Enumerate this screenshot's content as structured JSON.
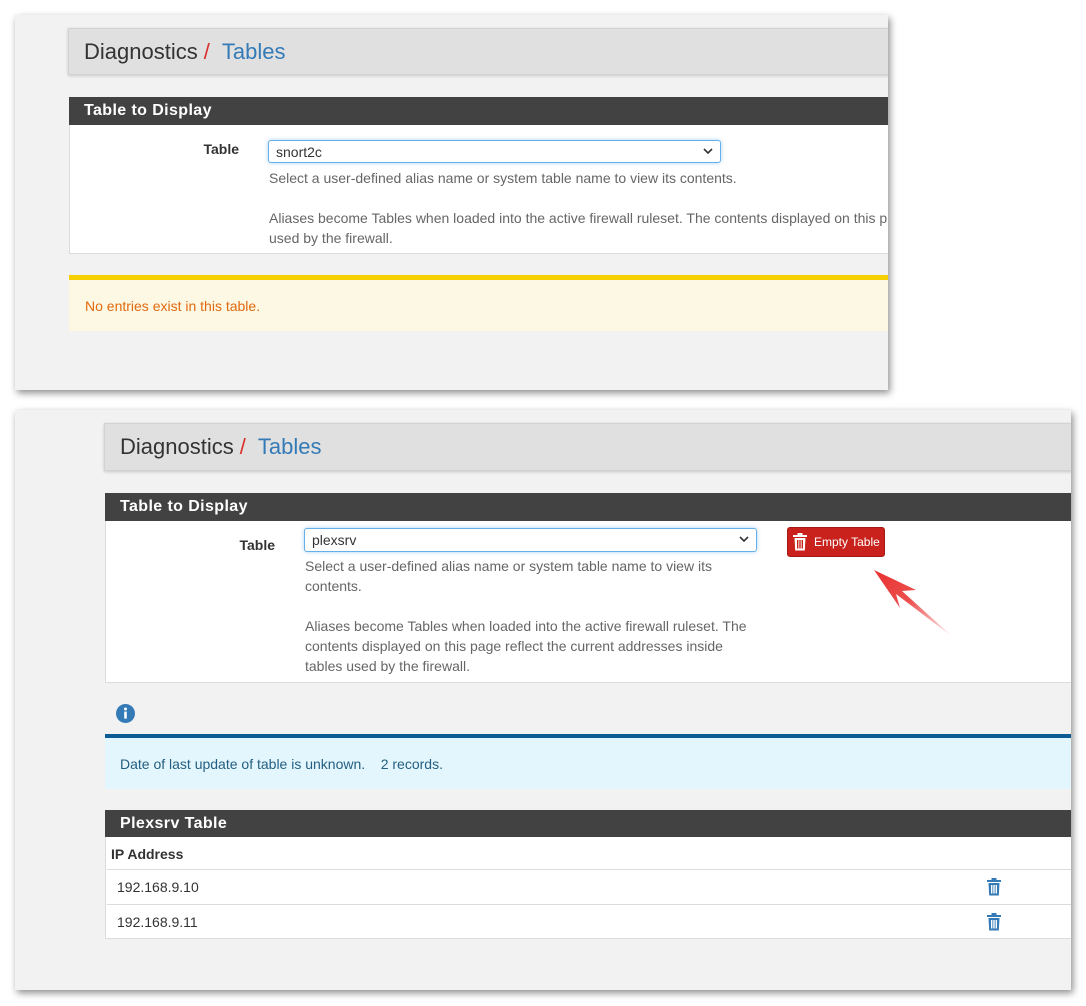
{
  "colors": {
    "panel_header_bg": "#424242",
    "link": "#337ab7",
    "breadcrumb_separator": "#d9302c",
    "warning_border": "#f6cf00",
    "warning_text": "#e2690f",
    "info_border": "#0c5b93",
    "danger_button": "#c9221c",
    "annotation_arrow": "#e8312f"
  },
  "screenshot_top": {
    "breadcrumb": {
      "root": "Diagnostics",
      "separator": "/",
      "current": "Tables"
    },
    "panel": {
      "title": "Table to Display",
      "table_label": "Table",
      "selected_table": "snort2c",
      "help_text_1": "Select a user-defined alias name or system table name to view its contents.",
      "help_text_2_line_1": "Aliases become Tables when loaded into the active firewall ruleset. The contents displayed on this p",
      "help_text_2_line_2": "used by the firewall."
    },
    "warning_message": "No entries exist in this table."
  },
  "screenshot_bottom": {
    "breadcrumb": {
      "root": "Diagnostics",
      "separator": "/",
      "current": "Tables"
    },
    "panel": {
      "title": "Table to Display",
      "table_label": "Table",
      "selected_table": "plexsrv",
      "help_text_1_line_1": "Select a user-defined alias name or system table name to view its",
      "help_text_1_line_2": "contents.",
      "help_text_2_line_1": "Aliases become Tables when loaded into the active firewall ruleset. The",
      "help_text_2_line_2": "contents displayed on this page reflect the current addresses inside",
      "help_text_2_line_3": "tables used by the firewall.",
      "empty_button_label": "Empty Table",
      "empty_button_icon": "trash-icon"
    },
    "info_icon": "info-circle-icon",
    "info_message": "Date of last update of table is unknown.    2 records.",
    "results": {
      "title": "Plexsrv Table",
      "column_header": "IP Address",
      "rows": [
        {
          "ip": "192.168.9.10",
          "action_icon": "trash-icon"
        },
        {
          "ip": "192.168.9.11",
          "action_icon": "trash-icon"
        }
      ]
    }
  }
}
